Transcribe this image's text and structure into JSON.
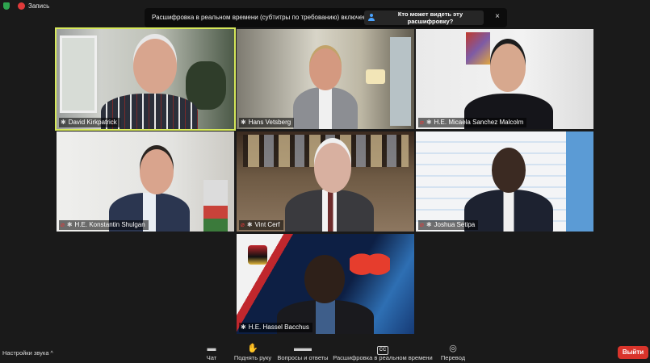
{
  "recording": {
    "label": "Запись"
  },
  "banner": {
    "text": "Расшифровка в реальном времени (субтитры по требованию) включена",
    "button_label": "Кто может видеть эту расшифровку?",
    "close_glyph": "×"
  },
  "participants": [
    {
      "name": "David Kirkpatrick",
      "muted": false,
      "pinned": true,
      "active_speaker": true
    },
    {
      "name": "Hans Vetsberg",
      "muted": false,
      "pinned": true,
      "active_speaker": false
    },
    {
      "name": "H.E. Micaela Sanchez Malcolm",
      "muted": true,
      "pinned": true,
      "active_speaker": false
    },
    {
      "name": "H.E. Konstantin Shulgan",
      "muted": true,
      "pinned": true,
      "active_speaker": false
    },
    {
      "name": "Vint Cerf",
      "muted": true,
      "pinned": true,
      "active_speaker": false
    },
    {
      "name": "Joshua Setipa",
      "muted": true,
      "pinned": true,
      "active_speaker": false
    },
    {
      "name": "H.E. Hassel Bacchus",
      "muted": false,
      "pinned": true,
      "active_speaker": false
    }
  ],
  "toolbar": {
    "audio_settings": "Настройки звука",
    "chat": "Чат",
    "raise_hand": "Поднять руку",
    "qa": "Вопросы и ответы",
    "live_transcript": "Расшифровка в реальном времени",
    "cc_icon": "CC",
    "translate": "Перевод",
    "leave": "Выйти"
  },
  "colors": {
    "active_speaker_border": "#d6e85a",
    "leave_button": "#d9342b",
    "muted_icon": "#e03a3a"
  }
}
